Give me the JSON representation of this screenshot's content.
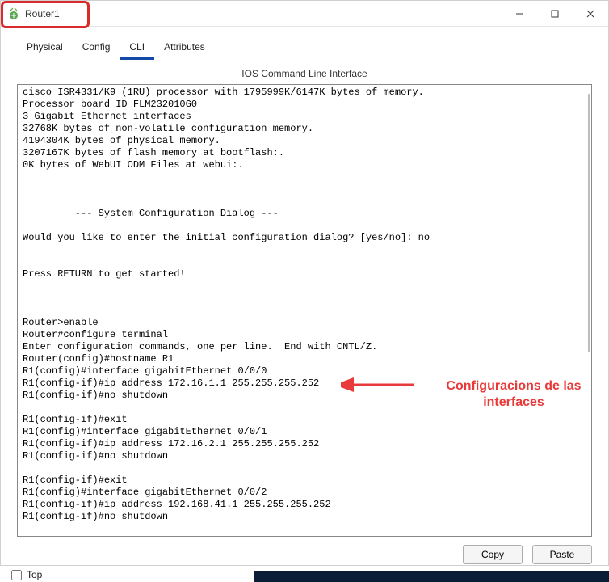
{
  "window": {
    "title": "Router1"
  },
  "tabs": {
    "physical": "Physical",
    "config": "Config",
    "cli": "CLI",
    "attributes": "Attributes"
  },
  "cli": {
    "header": "IOS Command Line Interface",
    "content": "cisco ISR4331/K9 (1RU) processor with 1795999K/6147K bytes of memory.\nProcessor board ID FLM232010G0\n3 Gigabit Ethernet interfaces\n32768K bytes of non-volatile configuration memory.\n4194304K bytes of physical memory.\n3207167K bytes of flash memory at bootflash:.\n0K bytes of WebUI ODM Files at webui:.\n\n\n\n         --- System Configuration Dialog ---\n\nWould you like to enter the initial configuration dialog? [yes/no]: no\n\n\nPress RETURN to get started!\n\n\n\nRouter>enable\nRouter#configure terminal\nEnter configuration commands, one per line.  End with CNTL/Z.\nRouter(config)#hostname R1\nR1(config)#interface gigabitEthernet 0/0/0\nR1(config-if)#ip address 172.16.1.1 255.255.255.252\nR1(config-if)#no shutdown\n\nR1(config-if)#exit\nR1(config)#interface gigabitEthernet 0/0/1\nR1(config-if)#ip address 172.16.2.1 255.255.255.252\nR1(config-if)#no shutdown\n\nR1(config-if)#exit\nR1(config)#interface gigabitEthernet 0/0/2\nR1(config-if)#ip address 192.168.41.1 255.255.255.252\nR1(config-if)#no shutdown"
  },
  "buttons": {
    "copy": "Copy",
    "paste": "Paste"
  },
  "footer": {
    "top": "Top"
  },
  "annotation": {
    "text": "Configuracions de las\ninterfaces"
  }
}
